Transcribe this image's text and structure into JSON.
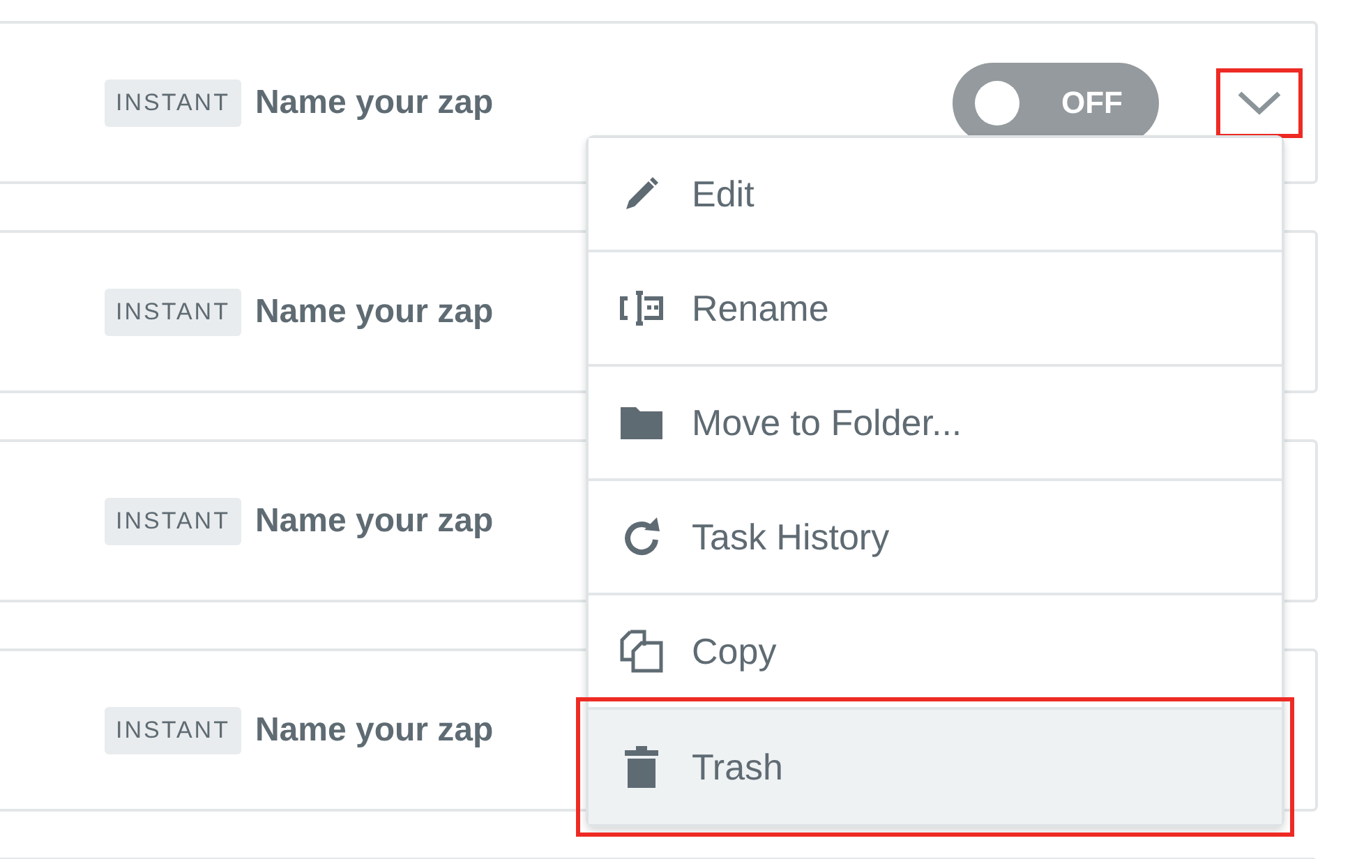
{
  "rows": [
    {
      "badge": "INSTANT",
      "name": "Name your zap",
      "toggle": {
        "label": "OFF",
        "on": false
      },
      "menu_button": {
        "expanded": true,
        "highlighted": true
      }
    },
    {
      "badge": "INSTANT",
      "name": "Name your zap"
    },
    {
      "badge": "INSTANT",
      "name": "Name your zap"
    },
    {
      "badge": "INSTANT",
      "name": "Name your zap"
    }
  ],
  "menu": {
    "items": [
      {
        "kind": "edit",
        "label": "Edit",
        "selected": false,
        "highlighted": false
      },
      {
        "kind": "rename",
        "label": "Rename",
        "selected": false,
        "highlighted": false
      },
      {
        "kind": "folder",
        "label": "Move to Folder...",
        "selected": false,
        "highlighted": false
      },
      {
        "kind": "history",
        "label": "Task History",
        "selected": false,
        "highlighted": false
      },
      {
        "kind": "copy",
        "label": "Copy",
        "selected": false,
        "highlighted": false
      },
      {
        "kind": "trash",
        "label": "Trash",
        "selected": true,
        "highlighted": true
      }
    ]
  }
}
